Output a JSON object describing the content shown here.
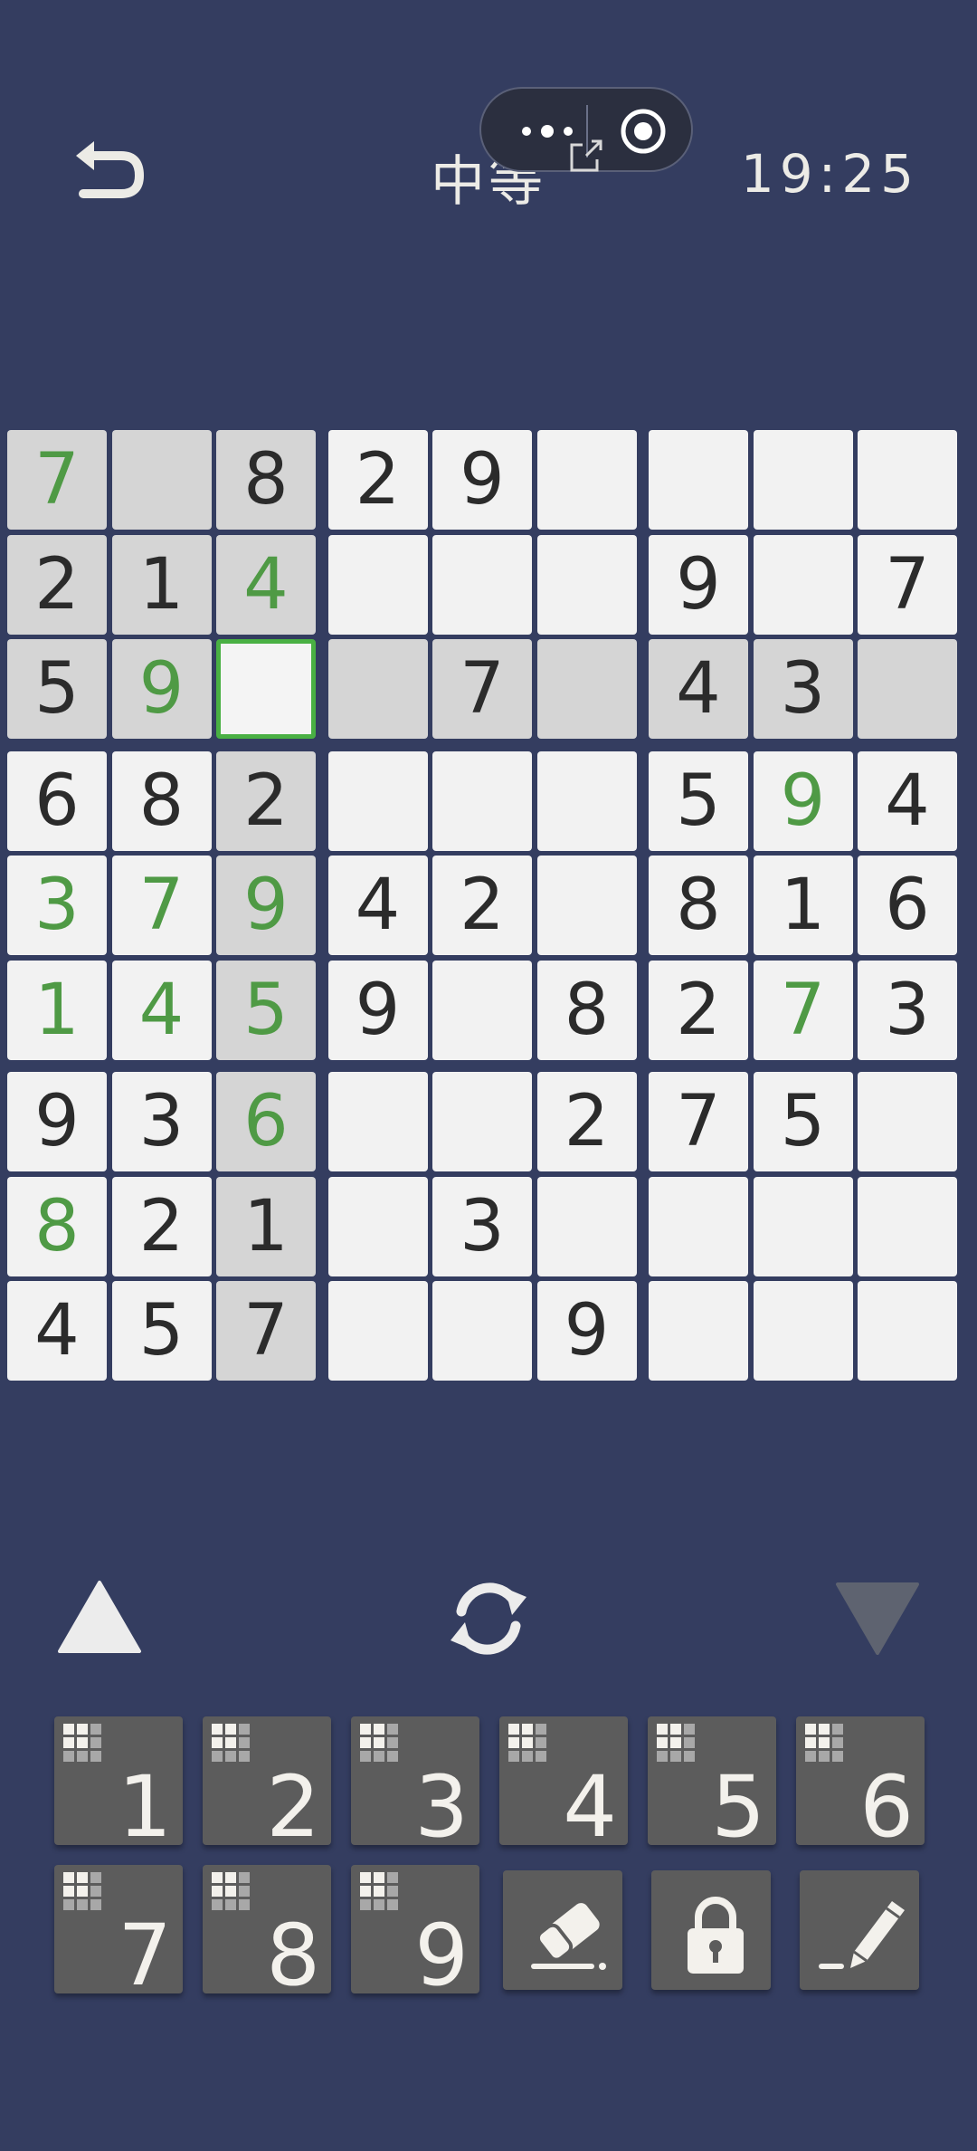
{
  "header": {
    "title": "中等",
    "timer": "19:25"
  },
  "board": {
    "selected": [
      2,
      2
    ],
    "cells": [
      [
        {
          "v": "7",
          "u": true
        },
        {
          "v": "",
          "u": false
        },
        {
          "v": "8",
          "u": false
        },
        {
          "v": "2",
          "u": false
        },
        {
          "v": "9",
          "u": false
        },
        {
          "v": "",
          "u": false
        },
        {
          "v": "",
          "u": false
        },
        {
          "v": "",
          "u": false
        },
        {
          "v": "",
          "u": false
        }
      ],
      [
        {
          "v": "2",
          "u": false
        },
        {
          "v": "1",
          "u": false
        },
        {
          "v": "4",
          "u": true
        },
        {
          "v": "",
          "u": false
        },
        {
          "v": "",
          "u": false
        },
        {
          "v": "",
          "u": false
        },
        {
          "v": "9",
          "u": false
        },
        {
          "v": "",
          "u": false
        },
        {
          "v": "7",
          "u": false
        }
      ],
      [
        {
          "v": "5",
          "u": false
        },
        {
          "v": "9",
          "u": true
        },
        {
          "v": "",
          "u": false
        },
        {
          "v": "",
          "u": false
        },
        {
          "v": "7",
          "u": false
        },
        {
          "v": "",
          "u": false
        },
        {
          "v": "4",
          "u": false
        },
        {
          "v": "3",
          "u": false
        },
        {
          "v": "",
          "u": false
        }
      ],
      [
        {
          "v": "6",
          "u": false
        },
        {
          "v": "8",
          "u": false
        },
        {
          "v": "2",
          "u": false
        },
        {
          "v": "",
          "u": false
        },
        {
          "v": "",
          "u": false
        },
        {
          "v": "",
          "u": false
        },
        {
          "v": "5",
          "u": false
        },
        {
          "v": "9",
          "u": true
        },
        {
          "v": "4",
          "u": false
        }
      ],
      [
        {
          "v": "3",
          "u": true
        },
        {
          "v": "7",
          "u": true
        },
        {
          "v": "9",
          "u": true
        },
        {
          "v": "4",
          "u": false
        },
        {
          "v": "2",
          "u": false
        },
        {
          "v": "",
          "u": false
        },
        {
          "v": "8",
          "u": false
        },
        {
          "v": "1",
          "u": false
        },
        {
          "v": "6",
          "u": false
        }
      ],
      [
        {
          "v": "1",
          "u": true
        },
        {
          "v": "4",
          "u": true
        },
        {
          "v": "5",
          "u": true
        },
        {
          "v": "9",
          "u": false
        },
        {
          "v": "",
          "u": false
        },
        {
          "v": "8",
          "u": false
        },
        {
          "v": "2",
          "u": false
        },
        {
          "v": "7",
          "u": true
        },
        {
          "v": "3",
          "u": false
        }
      ],
      [
        {
          "v": "9",
          "u": false
        },
        {
          "v": "3",
          "u": false
        },
        {
          "v": "6",
          "u": true
        },
        {
          "v": "",
          "u": false
        },
        {
          "v": "",
          "u": false
        },
        {
          "v": "2",
          "u": false
        },
        {
          "v": "7",
          "u": false
        },
        {
          "v": "5",
          "u": false
        },
        {
          "v": "",
          "u": false
        }
      ],
      [
        {
          "v": "8",
          "u": true
        },
        {
          "v": "2",
          "u": false
        },
        {
          "v": "1",
          "u": false
        },
        {
          "v": "",
          "u": false
        },
        {
          "v": "3",
          "u": false
        },
        {
          "v": "",
          "u": false
        },
        {
          "v": "",
          "u": false
        },
        {
          "v": "",
          "u": false
        },
        {
          "v": "",
          "u": false
        }
      ],
      [
        {
          "v": "4",
          "u": false
        },
        {
          "v": "5",
          "u": false
        },
        {
          "v": "7",
          "u": false
        },
        {
          "v": "",
          "u": false
        },
        {
          "v": "",
          "u": false
        },
        {
          "v": "9",
          "u": false
        },
        {
          "v": "",
          "u": false
        },
        {
          "v": "",
          "u": false
        },
        {
          "v": "",
          "u": false
        }
      ]
    ]
  },
  "keypad": {
    "digits": [
      "1",
      "2",
      "3",
      "4",
      "5",
      "6",
      "7",
      "8",
      "9"
    ],
    "tools": [
      "eraser-icon",
      "lock-icon",
      "pencil-icon"
    ]
  },
  "colors": {
    "background": "#343d60",
    "cell": "#f2f2f2",
    "cell_highlight": "#d5d5d5",
    "selected_border": "#49b043",
    "user_digit": "#4f9a45",
    "key": "#5c5c5c"
  }
}
